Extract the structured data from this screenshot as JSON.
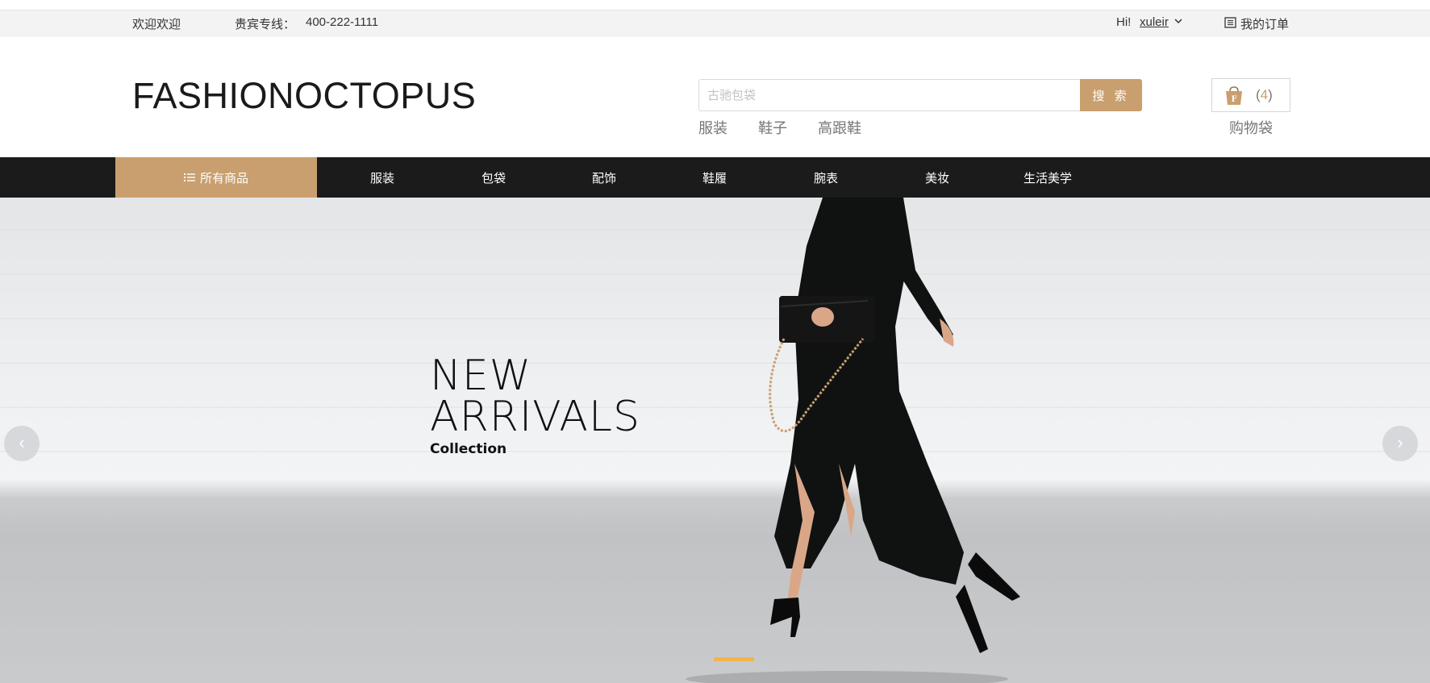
{
  "topbar": {
    "welcome": "欢迎欢迎",
    "hotline_label": "贵宾专线：",
    "hotline": "400-222-1111",
    "greeting": "Hi!",
    "username": "xuleir",
    "orders": "我的订单"
  },
  "header": {
    "logo": "FASHIONOCTOPUS",
    "search": {
      "placeholder": "古驰包袋",
      "value": "",
      "button": "搜 索"
    },
    "hot_tags": [
      "服装",
      "鞋子",
      "高跟鞋"
    ],
    "cart": {
      "count": "4",
      "label": "购物袋"
    }
  },
  "nav": {
    "all_label": "所有商品",
    "items": [
      "服装",
      "包袋",
      "配饰",
      "鞋履",
      "腕表",
      "美妆",
      "生活美学"
    ]
  },
  "hero": {
    "line1": "NEW",
    "line2": "ARRIVALS",
    "line3": "Collection",
    "prev": "‹",
    "next": "›",
    "slide_count": 1,
    "active_slide": 1
  },
  "colors": {
    "accent": "#c99f6f",
    "nav_bg": "#1b1b1b",
    "topbar_bg": "#f3f3f3",
    "indicator": "#f2b44b"
  },
  "icons": [
    "chevron-down-icon",
    "order-list-icon",
    "shopping-bag-icon",
    "list-menu-icon",
    "prev-arrow-icon",
    "next-arrow-icon"
  ]
}
